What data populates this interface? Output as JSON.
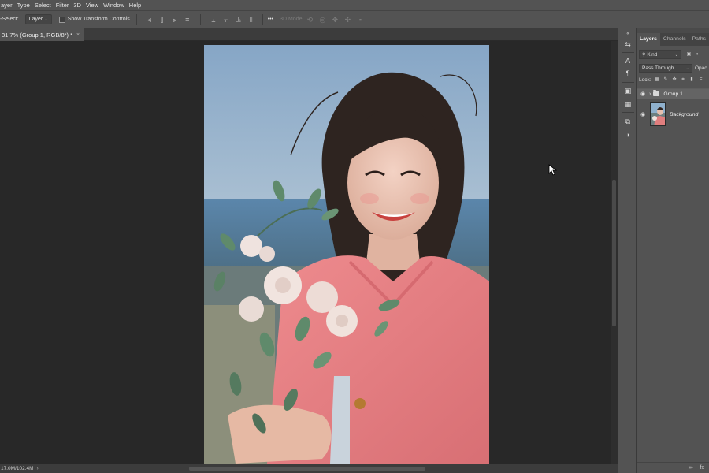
{
  "menubar": {
    "items": [
      "ayer",
      "Type",
      "Select",
      "Filter",
      "3D",
      "View",
      "Window",
      "Help"
    ]
  },
  "options": {
    "auto_select_label": "-Select:",
    "target_value": "Layer",
    "show_transform_label": "Show Transform Controls",
    "mode_3d_label": "3D Mode:",
    "more_label": "•••"
  },
  "document": {
    "tab_title": "31.7% (Group 1, RGB/8*) *",
    "close_label": "×"
  },
  "status": {
    "doc_size": "17.0M/102.4M"
  },
  "layers_panel": {
    "tabs": [
      "Layers",
      "Channels",
      "Paths"
    ],
    "filter_kind": "Kind",
    "blend_mode": "Pass Through",
    "opacity_label": "Opac",
    "lock_label": "Lock:",
    "fill_label": "F",
    "layers": [
      {
        "name": "Group 1",
        "type": "group",
        "visible": true,
        "selected": true
      },
      {
        "name": "Background",
        "type": "pixel",
        "visible": true,
        "selected": false
      }
    ],
    "bottom": [
      "∞",
      "fx"
    ]
  },
  "colors": {
    "ui_dark": "#282828",
    "ui_panel": "#535353",
    "sweater": "#e57c80",
    "sky": "#8fb0cc"
  }
}
